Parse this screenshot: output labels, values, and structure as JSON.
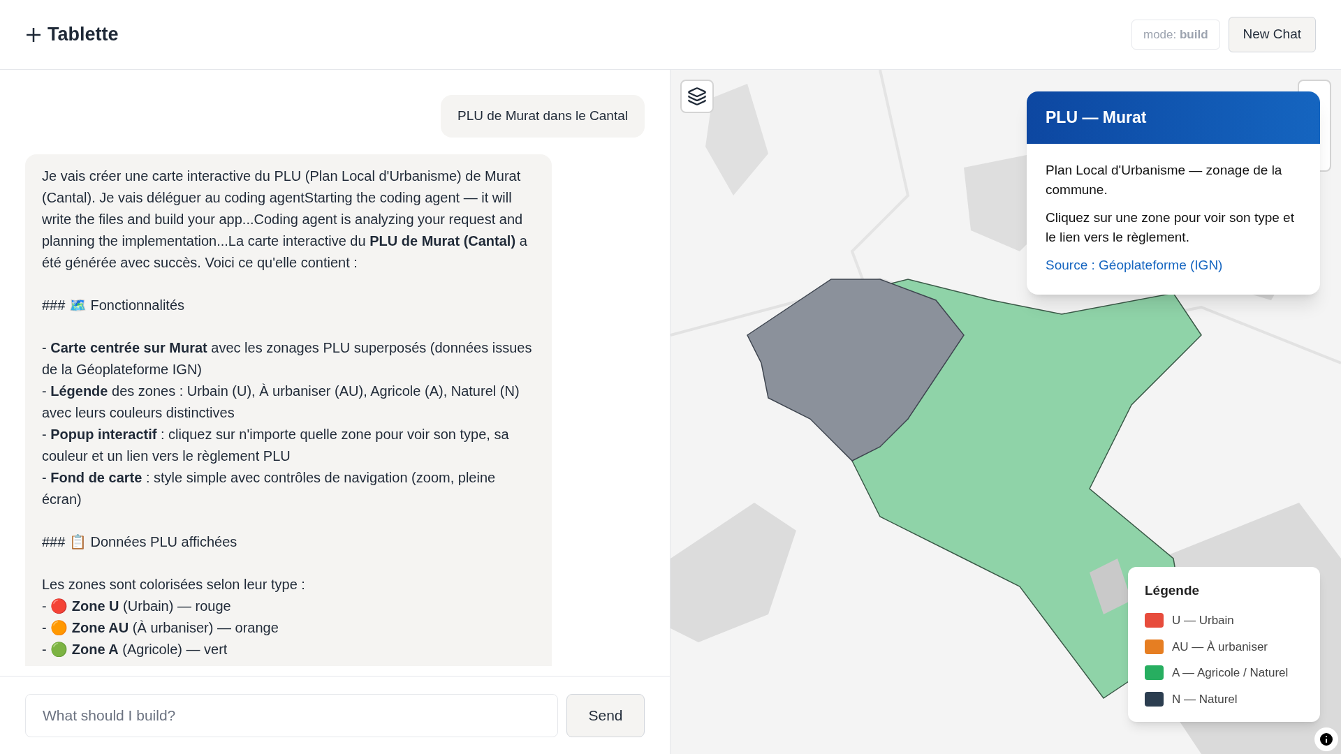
{
  "header": {
    "title": "Tablette",
    "mode": "mode: **build**",
    "new_chat": "New Chat"
  },
  "chat": {
    "messages": [
      {
        "kind": "user",
        "text": "PLU de Murat dans le Cantal"
      },
      {
        "kind": "assistant",
        "blocks": [
          {
            "kind": "paragraph",
            "text": "Je vais créer une carte interactive du PLU (Plan Local d'Urbanisme) de Murat (Cantal). Je vais déléguer au coding agentStarting the coding agent — it will write the files and build your app...Coding agent is analyzing your request and planning the implementation...La carte interactive du **PLU de Murat (Cantal)** a été générée avec succès. Voici ce qu'elle contient :"
          },
          {
            "kind": "heading",
            "text": "### 🗺️ Fonctionnalités"
          },
          {
            "kind": "list",
            "items": [
              "- **Carte centrée sur Murat** avec les zonages PLU superposés (données issues de la Géoplateforme IGN)",
              "- **Légende** des zones : Urbain (U), À urbaniser (AU), Agricole (A), Naturel (N) avec leurs couleurs distinctives",
              "- **Popup interactif** : cliquez sur n'importe quelle zone pour voir son type, sa couleur et un lien vers le règlement PLU",
              "- **Fond de carte** : style simple avec contrôles de navigation (zoom, pleine écran)"
            ]
          },
          {
            "kind": "heading",
            "text": "### 📋 Données PLU affichées"
          },
          {
            "kind": "list",
            "items": [
              "Les zones sont colorisées selon leur type :",
              "- 🔴 **Zone U** (Urbain) — rouge",
              "- 🟠 **Zone AU** (À urbaniser) — orange",
              "- 🟢 **Zone A** (Agricole) — vert"
            ]
          }
        ]
      }
    ],
    "input": {
      "placeholder": "What should I build?",
      "send": "Send"
    }
  },
  "map": {
    "popup": {
      "title": "PLU — Murat",
      "paragraphs": [
        "Plan Local d'Urbanisme — zonage de la commune.",
        "Cliquez sur une zone pour voir son type et le lien vers le règlement."
      ],
      "link": "Source : Géoplateforme (IGN)"
    },
    "legend": {
      "title": "Légende",
      "items": [
        {
          "label": "U — Urbain",
          "color": "#e74c3c"
        },
        {
          "label": "AU — À urbaniser",
          "color": "#e67e22"
        },
        {
          "label": "A — Agricole / Naturel",
          "color": "#27ae60"
        },
        {
          "label": "N — Naturel",
          "color": "#2c3e50"
        }
      ]
    }
  }
}
